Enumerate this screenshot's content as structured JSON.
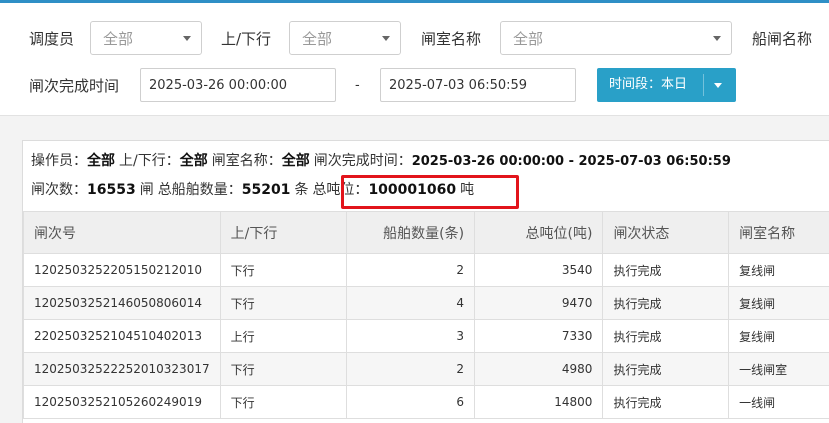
{
  "filters": {
    "operator_label": "调度员",
    "operator_value": "全部",
    "direction_label": "上/下行",
    "direction_value": "全部",
    "chamber_label": "闸室名称",
    "chamber_value": "全部",
    "lock_label": "船闸名称",
    "time_label": "闸次完成时间",
    "start_time": "2025-03-26 00:00:00",
    "dash": "-",
    "end_time": "2025-07-03 06:50:59",
    "period_button": "时间段：本日"
  },
  "summary": {
    "operator_label": "操作员：",
    "operator_value": "全部",
    "direction_label": "上/下行：",
    "direction_value": "全部",
    "chamber_label": "闸室名称：",
    "chamber_value": "全部",
    "time_label": "闸次完成时间：",
    "time_value": "2025-03-26 00:00:00 - 2025-07-03 06:50:59",
    "count_label": "闸次数：",
    "count_value": "16553",
    "count_unit": "闸",
    "ships_label": "总船舶数量：",
    "ships_value": "55201",
    "ships_unit": "条",
    "tonnage_label": "总吨位：",
    "tonnage_value": "100001060",
    "tonnage_unit": "吨",
    "highlight_color": "#e2141b"
  },
  "table": {
    "headers": [
      "闸次号",
      "上/下行",
      "船舶数量(条)",
      "总吨位(吨)",
      "闸次状态",
      "闸室名称"
    ],
    "rows": [
      [
        "120250325220515021201O",
        "下行",
        "2",
        "3540",
        "执行完成",
        "复线闸"
      ],
      [
        "120250325214605080601 4",
        "下行",
        "4",
        "9470",
        "执行完成",
        "复线闸"
      ],
      [
        "220250325210451040201 3",
        "上行",
        "3",
        "7330",
        "执行完成",
        "复线闸"
      ],
      [
        "120250325222520103230 17",
        "下行",
        "2",
        "4980",
        "执行完成",
        "一线闸室"
      ],
      [
        "120250325210526024901 9",
        "下行",
        "6",
        "14800",
        "执行完成",
        "一线闸"
      ]
    ]
  },
  "colors": {
    "accent": "#29a0c8",
    "top_bar": "#2f8fc6"
  }
}
